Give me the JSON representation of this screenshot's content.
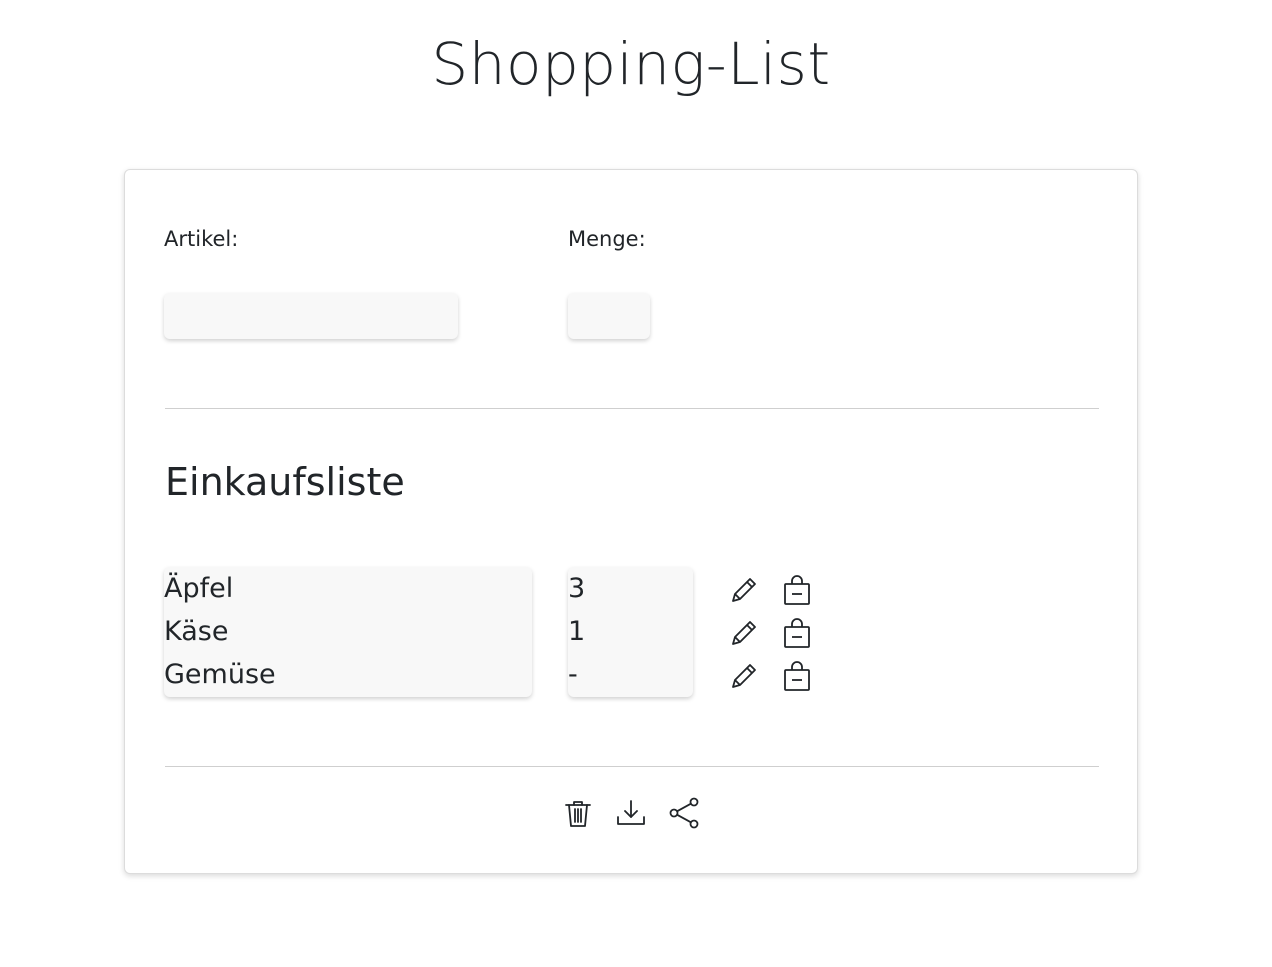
{
  "page": {
    "title": "Shopping-List"
  },
  "form": {
    "article_label": "Artikel:",
    "article_value": "",
    "quantity_label": "Menge:",
    "quantity_value": ""
  },
  "list": {
    "title": "Einkaufsliste",
    "items": [
      {
        "name": "Äpfel",
        "quantity": "3"
      },
      {
        "name": "Käse",
        "quantity": "1"
      },
      {
        "name": "Gemüse",
        "quantity": "-"
      }
    ],
    "row_icons": [
      "pencil-icon",
      "bag-dash-icon"
    ]
  },
  "footer": {
    "icons": [
      "trash-icon",
      "download-icon",
      "share-icon"
    ]
  },
  "colors": {
    "text": "#212529",
    "input_bg": "#f8f8f8",
    "divider": "#cfcfcf"
  }
}
